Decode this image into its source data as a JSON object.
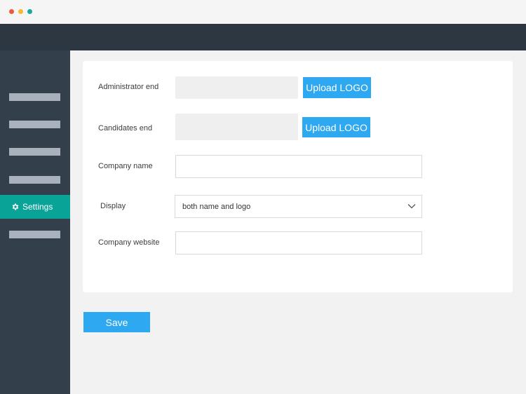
{
  "window": {
    "dot_colors": [
      "#f0583c",
      "#f5b82e",
      "#1aa89d"
    ]
  },
  "sidebar": {
    "active_item": {
      "label": "Settings",
      "icon": "gear-icon"
    }
  },
  "form": {
    "admin_logo": {
      "label": "Administrator end",
      "button": "Upload LOGO"
    },
    "candidate_logo": {
      "label": "Candidates end",
      "button": "Upload LOGO"
    },
    "company_name": {
      "label": "Company name",
      "value": ""
    },
    "display": {
      "label": "Display",
      "selected": "both name and logo"
    },
    "company_website": {
      "label": "Company website",
      "value": ""
    }
  },
  "actions": {
    "save_label": "Save"
  },
  "colors": {
    "accent": "#2ea8f0",
    "sidebar_active": "#0aa398",
    "sidebar_bg": "#343f4c",
    "topbar_bg": "#2d3742"
  }
}
